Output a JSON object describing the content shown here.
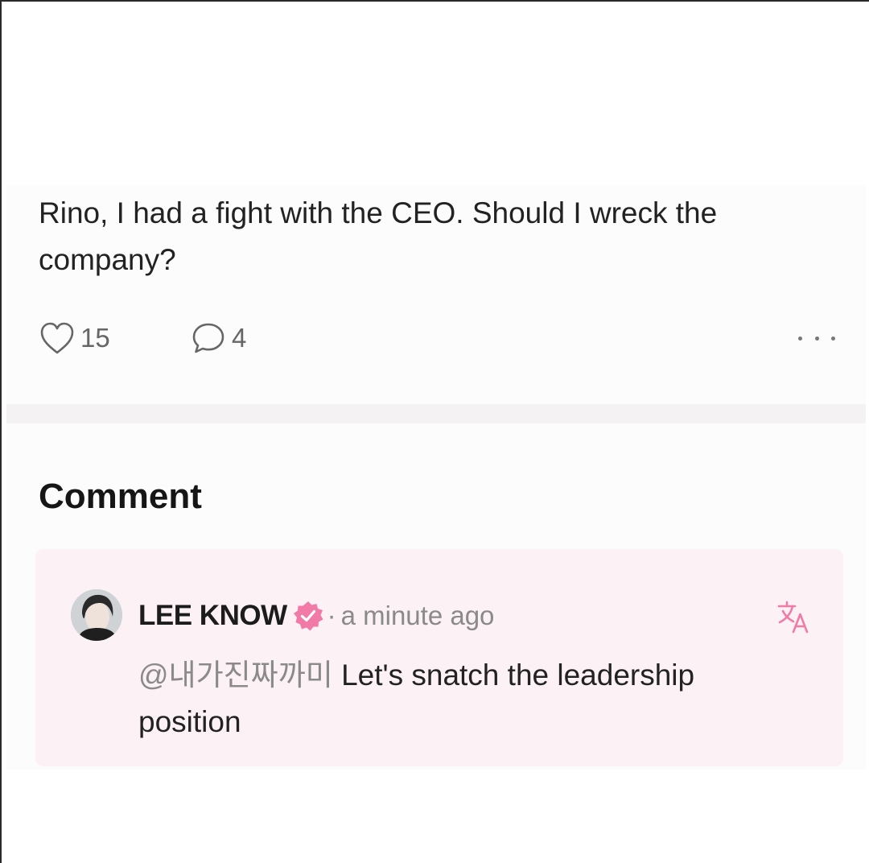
{
  "post": {
    "text": "Rino, I had a fight with the CEO. Should I wreck the company?",
    "like_icon": "heart-outline-icon",
    "like_count": "15",
    "comment_icon": "speech-bubble-icon",
    "comment_count": "4",
    "more_icon": "more-horizontal-icon"
  },
  "comments_section": {
    "title": "Comment"
  },
  "comment": {
    "author": "LEE KNOW",
    "verified_icon": "verified-badge-icon",
    "separator": "·",
    "time": "a minute ago",
    "translate_icon": "translate-icon",
    "mention": "@내가진짜까미",
    "text": "Let's snatch the leadership position"
  },
  "colors": {
    "accent_pink": "#f27aa6",
    "muted_text": "#8a8a8a",
    "comment_bg": "#fcf1f4"
  }
}
